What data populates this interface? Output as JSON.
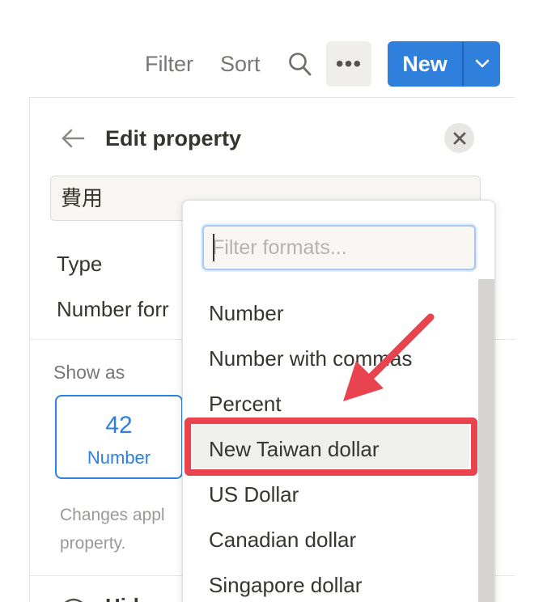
{
  "toolbar": {
    "filter_label": "Filter",
    "sort_label": "Sort",
    "search_icon": "search-icon",
    "more_label": "•••",
    "new_label": "New",
    "new_dropdown_icon": "chevron-down-icon"
  },
  "panel": {
    "title": "Edit property",
    "back_icon": "arrow-left-icon",
    "close_icon": "close-icon",
    "property_name": "費用",
    "type_label": "Type",
    "number_format_label": "Number forr",
    "show_as_label": "Show as",
    "show_as_option": {
      "value": "42",
      "label": "Number"
    },
    "help_text": "Changes appl property.",
    "hidden_row_label": "Hid"
  },
  "dropdown": {
    "filter_placeholder": "Filter formats...",
    "options": [
      "Number",
      "Number with commas",
      "Percent",
      "New Taiwan dollar",
      "US Dollar",
      "Canadian dollar",
      "Singapore dollar"
    ],
    "selected": "New Taiwan dollar"
  },
  "annotation": {
    "color": "#e8434f"
  },
  "colors": {
    "accent": "#2f80dd",
    "text": "#37352f",
    "muted": "#787774"
  }
}
